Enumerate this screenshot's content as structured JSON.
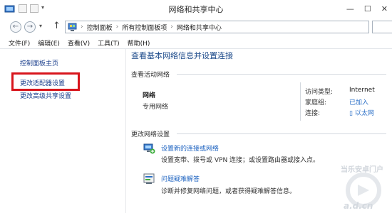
{
  "window": {
    "title": "网络和共享中心"
  },
  "titlebar": {
    "controls": [
      "—",
      "☐",
      "✕"
    ]
  },
  "navbar": {
    "back": "←",
    "forward": "→",
    "dropdown": "▾",
    "up": "↑",
    "breadcrumbs": [
      "控制面板",
      "所有控制面板项",
      "网络和共享中心"
    ],
    "separator": "›"
  },
  "menubar": {
    "items": [
      "文件(F)",
      "编辑(E)",
      "查看(V)",
      "工具(T)",
      "帮助(H)"
    ]
  },
  "sidebar": {
    "items": [
      "控制面板主页",
      "更改适配器设置",
      "更改高级共享设置"
    ]
  },
  "main": {
    "title": "查看基本网络信息并设置连接",
    "active_networks_label": "查看活动网络",
    "network": {
      "name": "网络",
      "type": "专用网络",
      "access_type_label": "访问类型:",
      "access_type_value": "Internet",
      "homegroup_label": "家庭组:",
      "homegroup_value": "已加入",
      "connections_label": "连接:",
      "connections_value": "以太网"
    },
    "change_settings_label": "更改网络设置",
    "tasks": [
      {
        "link": "设置新的连接或网络",
        "desc": "设置宽带、拨号或 VPN 连接；或设置路由器或接入点。",
        "icon": "new-connection-icon"
      },
      {
        "link": "问题疑难解答",
        "desc": "诊断并修复网络问题，或者获得疑难解答信息。",
        "icon": "troubleshoot-icon"
      }
    ]
  },
  "watermark": {
    "line1": "当乐安卓门户",
    "line2": "a.d.cn"
  },
  "colors": {
    "highlight": "#d8151c",
    "link": "#1f64c1",
    "title": "#1c4a8a"
  }
}
